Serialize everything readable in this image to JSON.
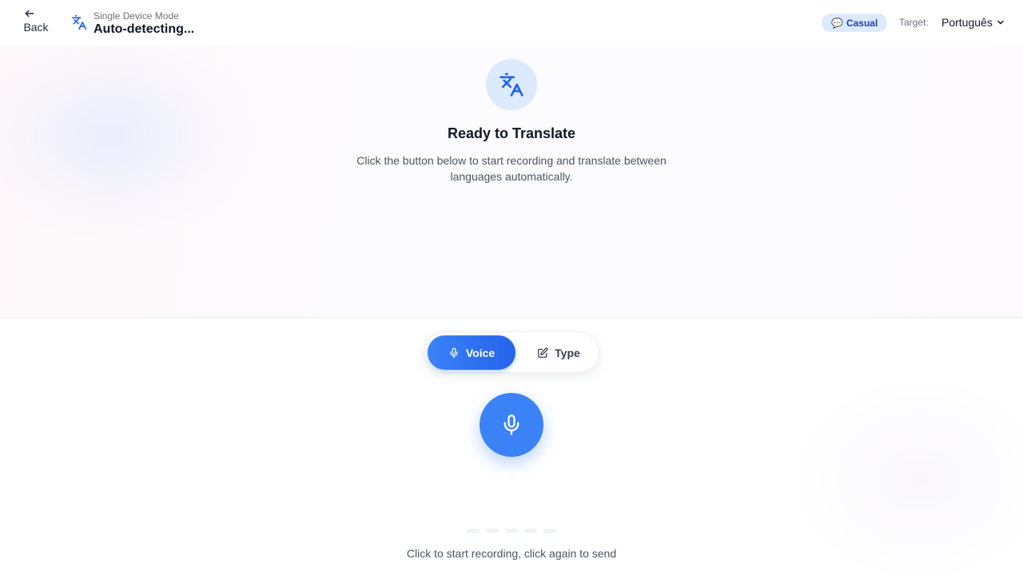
{
  "header": {
    "back_label": "Back",
    "mode_subtitle": "Single Device Mode",
    "mode_title": "Auto-detecting...",
    "tone_badge": {
      "emoji": "💬",
      "label": "Casual"
    },
    "target_label": "Target:",
    "target_value": "Português"
  },
  "ready": {
    "title": "Ready to Translate",
    "description": "Click the button below to start recording and translate between languages automatically."
  },
  "input_mode": {
    "options": [
      {
        "label": "Voice",
        "icon": "microphone-icon",
        "selected": true
      },
      {
        "label": "Type",
        "icon": "edit-icon",
        "selected": false
      }
    ]
  },
  "recording": {
    "hint": "Click to start recording, click again to send"
  },
  "colors": {
    "accent": "#3b82f6",
    "accent_dark": "#2563eb",
    "badge_bg": "#dbeafe",
    "badge_text": "#1e40af"
  }
}
